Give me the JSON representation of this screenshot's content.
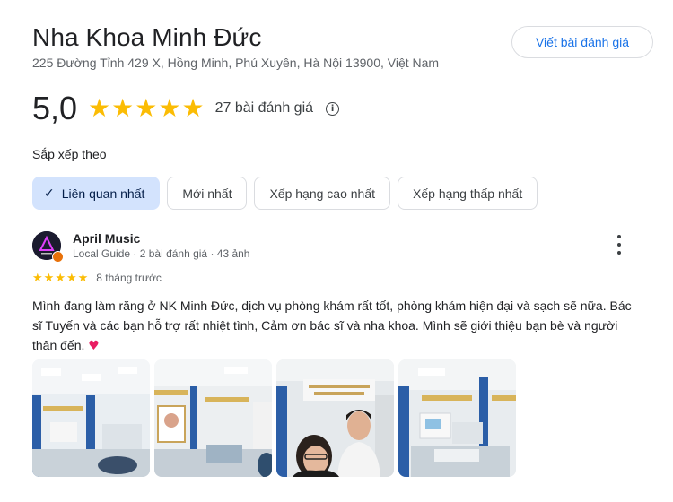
{
  "place": {
    "name": "Nha Khoa Minh Đức",
    "address": "225 Đường Tỉnh 429 X, Hồng Minh, Phú Xuyên, Hà Nội 13900, Việt Nam",
    "write_review_label": "Viết bài đánh giá",
    "rating": "5,0",
    "rating_stars": 5,
    "review_count_text": "27 bài đánh giá",
    "info_symbol": "i"
  },
  "sort": {
    "label": "Sắp xếp theo",
    "check_symbol": "✓",
    "options": [
      {
        "label": "Liên quan nhất",
        "selected": true
      },
      {
        "label": "Mới nhất",
        "selected": false
      },
      {
        "label": "Xếp hạng cao nhất",
        "selected": false
      },
      {
        "label": "Xếp hạng thấp nhất",
        "selected": false
      }
    ]
  },
  "review": {
    "reviewer_name": "April Music",
    "reviewer_meta": "Local Guide · 2 bài đánh giá · 43 ảnh",
    "stars": 5,
    "time": "8 tháng trước",
    "text": "Mình đang làm răng ở NK Minh Đức, dịch vụ phòng khám rất tốt, phòng khám hiện đại và sạch sẽ nữa. Bác sĩ Tuyến và các bạn hỗ trợ rất nhiệt tình, Cảm ơn bác sĩ và nha khoa. Mình sẽ giới thiệu bạn bè và người thân đến.",
    "emoji": "♥",
    "photo_count": 4
  },
  "icons": {
    "star": "star-icon",
    "info": "info-icon",
    "check": "check-icon",
    "more": "more-vert-icon",
    "heart": "heart-icon"
  },
  "colors": {
    "star": "#fbbc04",
    "accent": "#1a73e8",
    "chip_selected_bg": "#d3e3fd",
    "heart": "#e91e63",
    "badge": "#e8710a"
  }
}
